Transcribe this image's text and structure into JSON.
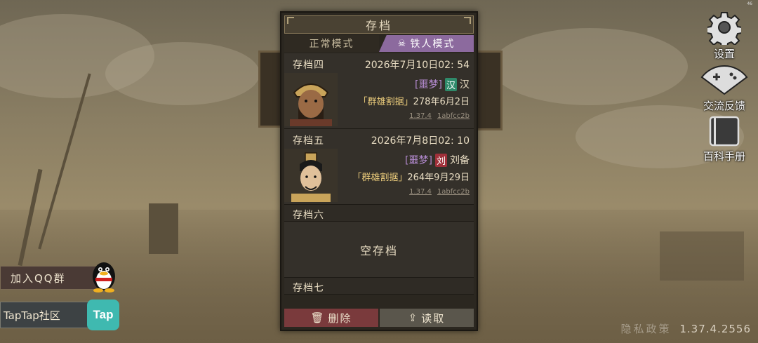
{
  "status": {
    "corner": "46"
  },
  "left": {
    "qq_label": "加入QQ群",
    "taptap_label": "TapTap社区",
    "taptap_logo": "Tap"
  },
  "right": {
    "settings_label": "设置",
    "feedback_label": "交流反馈",
    "wiki_label": "百科手册"
  },
  "bottom": {
    "privacy": "隐私政策",
    "version": "1.37.4.2556"
  },
  "panel": {
    "title": "存档",
    "tabs": {
      "normal": "正常模式",
      "iron": "铁人模式"
    },
    "slots": [
      {
        "name": "存档四",
        "date": "2026年7月10日02: 54",
        "difficulty": "[噩梦]",
        "faction_char": "汉",
        "faction_color": "#2f8a6a",
        "ruler": "汉",
        "scenario": "「群雄割据」",
        "game_date": "278年6月2日",
        "version": "1.37.4",
        "hash": "1abfcc2b"
      },
      {
        "name": "存档五",
        "date": "2026年7月8日02: 10",
        "difficulty": "[噩梦]",
        "faction_char": "刘",
        "faction_color": "#a0303a",
        "ruler": "刘备",
        "scenario": "「群雄割据」",
        "game_date": "264年9月29日",
        "version": "1.37.4",
        "hash": "1abfcc2b"
      }
    ],
    "empty_slot": {
      "name": "存档六",
      "label": "空存档"
    },
    "next_slot": {
      "name": "存档七"
    },
    "buttons": {
      "delete": "删除",
      "load": "读取"
    }
  }
}
